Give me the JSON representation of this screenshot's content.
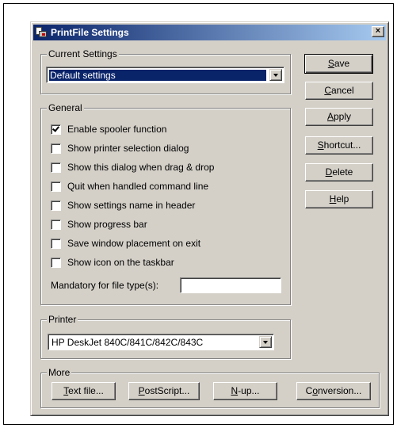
{
  "window": {
    "title": "PrintFile Settings",
    "close_glyph": "×"
  },
  "current_settings": {
    "label": "Current Settings",
    "selected": "Default settings"
  },
  "general": {
    "label": "General",
    "options": [
      {
        "label": "Enable spooler function",
        "checked": true
      },
      {
        "label": "Show printer selection dialog",
        "checked": false
      },
      {
        "label": "Show this dialog when drag & drop",
        "checked": false
      },
      {
        "label": "Quit when handled command line",
        "checked": false
      },
      {
        "label": "Show settings name in header",
        "checked": false
      },
      {
        "label": "Show progress bar",
        "checked": false
      },
      {
        "label": "Save window placement on exit",
        "checked": false
      },
      {
        "label": "Show icon on the taskbar",
        "checked": false
      }
    ],
    "mandatory_label": "Mandatory for file type(s):",
    "mandatory_value": ""
  },
  "printer": {
    "label": "Printer",
    "selected": "HP DeskJet 840C/841C/842C/843C"
  },
  "more": {
    "label": "More",
    "buttons": [
      {
        "mnemonic": "T",
        "rest": "ext file..."
      },
      {
        "mnemonic": "P",
        "rest": "ostScript..."
      },
      {
        "mnemonic": "N",
        "rest": "-up..."
      },
      {
        "prefix": "C",
        "mnemonic": "o",
        "rest": "nversion..."
      }
    ]
  },
  "side_buttons": {
    "save": {
      "mnemonic": "S",
      "rest": "ave"
    },
    "cancel": {
      "mnemonic": "C",
      "rest": "ancel"
    },
    "apply": {
      "mnemonic": "A",
      "rest": "pply"
    },
    "shortcut": {
      "mnemonic": "S",
      "rest": "hortcut..."
    },
    "delete": {
      "mnemonic": "D",
      "rest": "elete"
    },
    "help": {
      "mnemonic": "H",
      "rest": "elp"
    }
  },
  "colors": {
    "face": "#d4d0c8",
    "title_start": "#0a246a",
    "title_end": "#a6caf0",
    "selection": "#0a246a"
  },
  "icons": {
    "app": "printer-icon",
    "close": "close-icon",
    "dropdown": "chevron-down-icon",
    "check": "checkmark-icon"
  }
}
